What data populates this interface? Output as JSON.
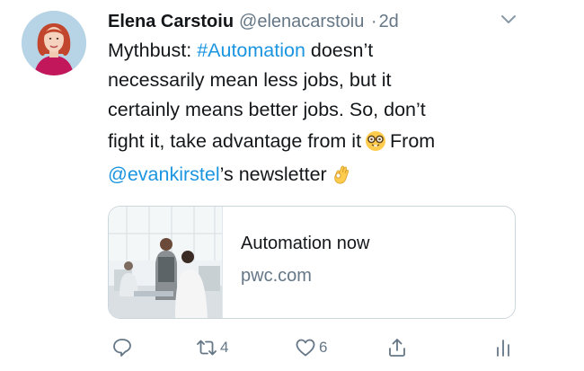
{
  "author": {
    "name": "Elena Carstoiu",
    "handle": "@elenacarstoiu",
    "separator": "·",
    "time": "2d"
  },
  "tweet": {
    "line1": {
      "prefix": "Mythbust: ",
      "hashtag": "#Automation",
      "suffix": " doesn’t"
    },
    "line2": "necessarily mean less jobs, but it",
    "line3": "certainly means better jobs. So, don’t",
    "line4": {
      "text": "fight it, take advantage from it",
      "emoji": "nerd-face-emoji",
      "after": "From"
    },
    "line5": {
      "mention": "@evankirstel",
      "text": "’s newsletter",
      "emoji": "ok-hand-emoji"
    }
  },
  "card": {
    "title": "Automation now",
    "domain": "pwc.com",
    "image": "office-workers-photo"
  },
  "actions": {
    "reply": {
      "icon": "reply-icon",
      "count": ""
    },
    "retweet": {
      "icon": "retweet-icon",
      "count": "4"
    },
    "like": {
      "icon": "heart-icon",
      "count": "6"
    },
    "share": {
      "icon": "share-icon",
      "count": ""
    },
    "analytics": {
      "icon": "analytics-icon",
      "count": ""
    }
  },
  "colors": {
    "link": "#1b95e0",
    "text": "#14171a",
    "secondary": "#657786",
    "border": "#ccd6dd"
  }
}
